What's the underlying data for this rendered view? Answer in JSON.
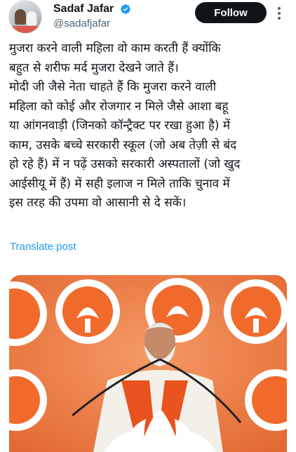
{
  "author": {
    "display_name": "Sadaf Jafar",
    "handle": "@sadafjafar",
    "verified": true,
    "avatar_icon": "profile-photo"
  },
  "actions": {
    "follow_label": "Follow",
    "more_icon": "more-vertical-icon"
  },
  "post": {
    "lines": [
      "मुजरा करने वाली महिला वो काम करती हैं क्योंकि",
      "बहुत से शरीफ मर्द मुजरा देखने जाते हैं।",
      "मोदी जी जैसे नेता चाहते हैं कि मुजरा करने वाली",
      "महिला को कोई और रोजगार न मिले जैसे आशा बहू",
      "या आंगनवाड़ी (जिनको कॉन्ट्रैक्ट पर रखा हुआ है) में",
      "काम, उसके बच्चे सरकारी स्कूल (जो अब तेज़ी से बंद",
      "हो रहे हैं) में न पढ़ें उसको सरकारी अस्पतालों (जो खुद",
      "आईसीयू में हैं) में सही इलाज न मिले ताकि चुनाव में",
      "इस तरह की उपमा वो आसानी से दे सकें।"
    ],
    "translate_label": "Translate post"
  },
  "media": {
    "kind": "photo",
    "subject": "speaker at podium with lotus emblem backdrop",
    "colors": {
      "backdrop": "#e8743f",
      "emblem_ring": "#ffffff",
      "emblem_fill": "#f06a2b",
      "kurta": "#f3f0ea",
      "scarf": "#e8531f"
    }
  },
  "colors": {
    "text": "#0f1419",
    "secondary": "#536471",
    "link": "#1d9bf0",
    "verified": "#1d9bf0",
    "button_bg": "#0f1419"
  }
}
